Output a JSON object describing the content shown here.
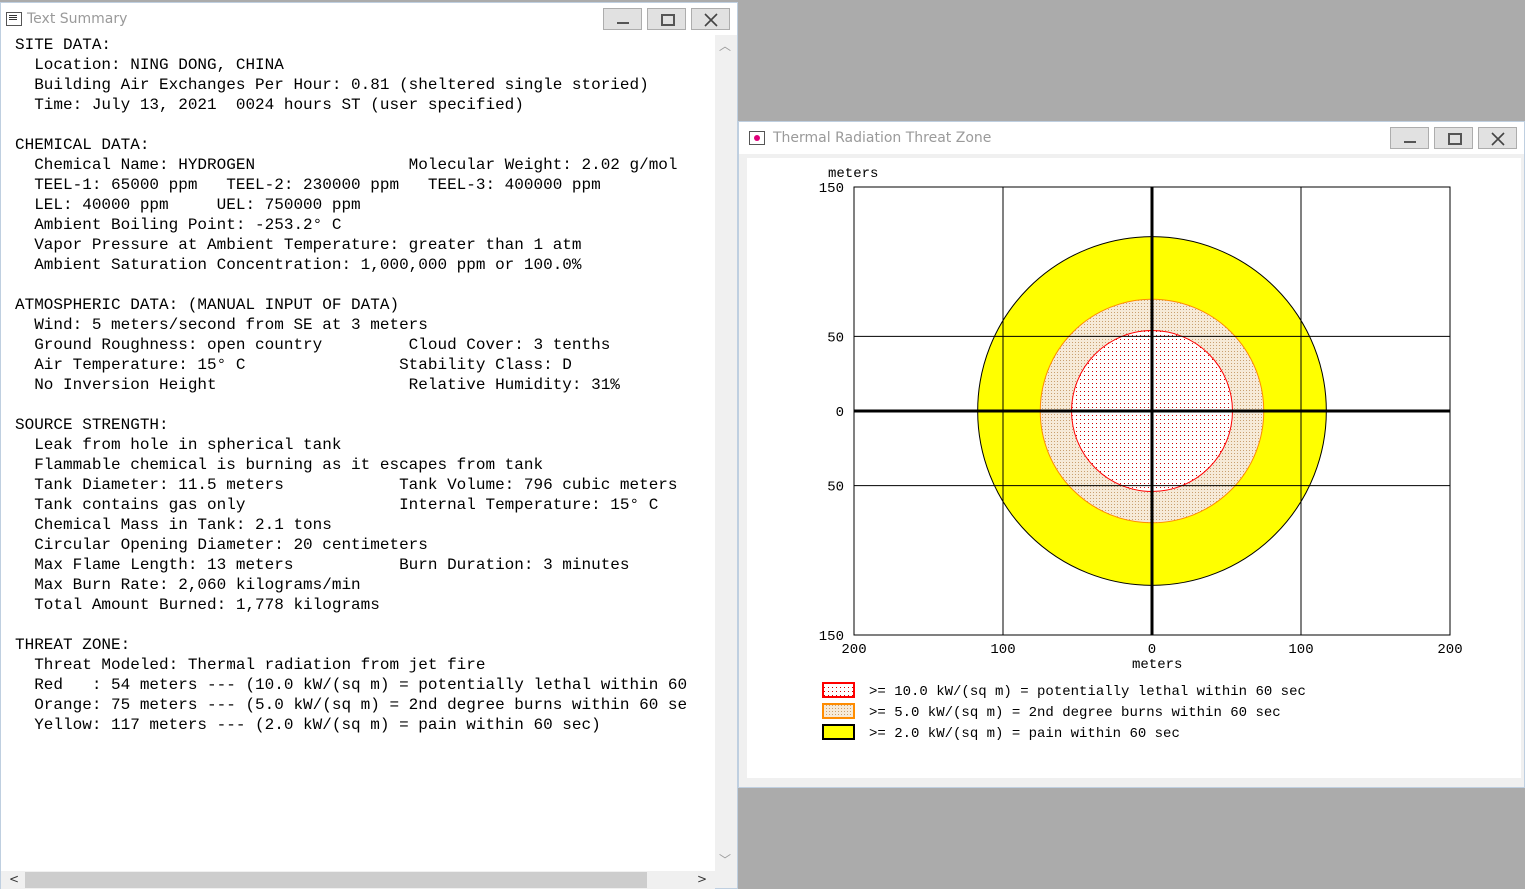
{
  "text_window": {
    "title": "Text Summary",
    "lines": [
      "SITE DATA:",
      "  Location: NING DONG, CHINA",
      "  Building Air Exchanges Per Hour: 0.81 (sheltered single storied)",
      "  Time: July 13, 2021  0024 hours ST (user specified)",
      "",
      "CHEMICAL DATA:",
      "  Chemical Name: HYDROGEN                Molecular Weight: 2.02 g/mol",
      "  TEEL-1: 65000 ppm   TEEL-2: 230000 ppm   TEEL-3: 400000 ppm",
      "  LEL: 40000 ppm     UEL: 750000 ppm",
      "  Ambient Boiling Point: -253.2° C",
      "  Vapor Pressure at Ambient Temperature: greater than 1 atm",
      "  Ambient Saturation Concentration: 1,000,000 ppm or 100.0%",
      "",
      "ATMOSPHERIC DATA: (MANUAL INPUT OF DATA)",
      "  Wind: 5 meters/second from SE at 3 meters",
      "  Ground Roughness: open country         Cloud Cover: 3 tenths",
      "  Air Temperature: 15° C                Stability Class: D",
      "  No Inversion Height                    Relative Humidity: 31%",
      "",
      "SOURCE STRENGTH:",
      "  Leak from hole in spherical tank",
      "  Flammable chemical is burning as it escapes from tank",
      "  Tank Diameter: 11.5 meters            Tank Volume: 796 cubic meters",
      "  Tank contains gas only                Internal Temperature: 15° C",
      "  Chemical Mass in Tank: 2.1 tons",
      "  Circular Opening Diameter: 20 centimeters",
      "  Max Flame Length: 13 meters           Burn Duration: 3 minutes",
      "  Max Burn Rate: 2,060 kilograms/min",
      "  Total Amount Burned: 1,778 kilograms",
      "",
      "THREAT ZONE:",
      "  Threat Modeled: Thermal radiation from jet fire",
      "  Red   : 54 meters --- (10.0 kW/(sq m) = potentially lethal within 60",
      "  Orange: 75 meters --- (5.0 kW/(sq m) = 2nd degree burns within 60 se",
      "  Yellow: 117 meters --- (2.0 kW/(sq m) = pain within 60 sec)"
    ]
  },
  "plot_window": {
    "title": "Thermal Radiation Threat Zone"
  },
  "chart_data": {
    "type": "area",
    "title": "",
    "xlabel": "meters",
    "ylabel": "meters",
    "xlim": [
      -200,
      200
    ],
    "ylim": [
      -150,
      150
    ],
    "x_ticks": [
      -200,
      -100,
      0,
      100,
      200
    ],
    "y_ticks": [
      -150,
      -50,
      0,
      50,
      150
    ],
    "x_tick_labels": [
      "200",
      "100",
      "0",
      "100",
      "200"
    ],
    "y_tick_labels": [
      "150",
      "50",
      "0",
      "50",
      "150"
    ],
    "grid": true,
    "zones": [
      {
        "name": ">= 2.0 kW/(sq m) = pain within 60 sec",
        "radius": 117,
        "fill": "#ffff00",
        "stroke": "#000000"
      },
      {
        "name": ">= 5.0 kW/(sq m) = 2nd degree burns within 60 sec",
        "radius": 75,
        "fill": "#f2e4d0",
        "stroke": "#ff8c00"
      },
      {
        "name": ">= 10.0 kW/(sq m) = potentially lethal within 60 sec",
        "radius": 54,
        "fill": "#ffffff",
        "stroke": "#ff0000"
      }
    ],
    "legend": [
      {
        "label": ">= 10.0 kW/(sq m) = potentially lethal within 60 sec",
        "fill": "#ffffff",
        "stroke": "#ff0000"
      },
      {
        "label": ">= 5.0 kW/(sq m) = 2nd degree burns within 60 sec",
        "fill": "#f2e4d0",
        "stroke": "#ff8c00"
      },
      {
        "label": ">= 2.0 kW/(sq m) = pain within 60 sec",
        "fill": "#ffff00",
        "stroke": "#000000"
      }
    ],
    "legend_position": "bottom-left"
  }
}
